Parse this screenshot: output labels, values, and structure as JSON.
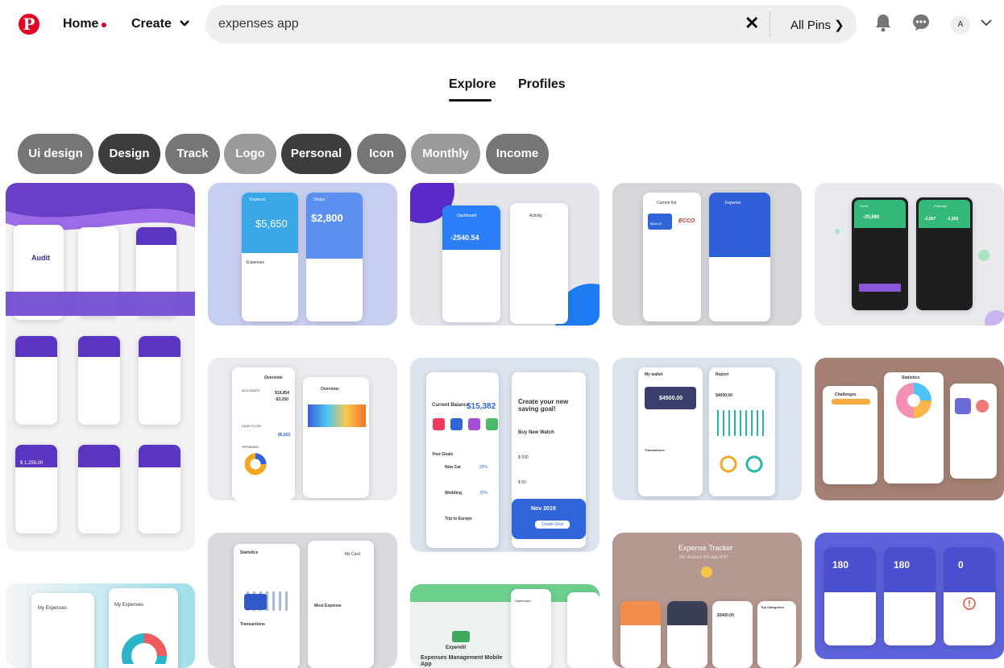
{
  "header": {
    "logo": "P",
    "home_label": "Home",
    "create_label": "Create",
    "create_chevron": "chevron-down-icon",
    "search_value": "expenses app",
    "clear_glyph": "✕",
    "filter_label": "All Pins ❯",
    "avatar_initial": "A",
    "colors": {
      "brand": "#e60023",
      "search_bg": "#efefef"
    }
  },
  "tabs": [
    {
      "label": "Explore",
      "active": true
    },
    {
      "label": "Profiles",
      "active": false
    }
  ],
  "chips": [
    {
      "label": "Ui design",
      "color": "#767676"
    },
    {
      "label": "Design",
      "color": "#3d3d3d"
    },
    {
      "label": "Track",
      "color": "#767676"
    },
    {
      "label": "Logo",
      "color": "#9a9a9a"
    },
    {
      "label": "Personal",
      "color": "#3d3d3d"
    },
    {
      "label": "Icon",
      "color": "#767676"
    },
    {
      "label": "Monthly",
      "color": "#9a9a9a"
    },
    {
      "label": "Income",
      "color": "#767676"
    }
  ],
  "pins": {
    "p1": {
      "brand": "Audit",
      "balance": "$ 1,256.00"
    },
    "p2": {
      "left_title": "Expense",
      "left_amount": "$5,650",
      "right_title": "Shops",
      "right_amount": "$2,800",
      "section": "Expenses"
    },
    "p3": {
      "title": "Dashboard",
      "amount": "-2540.54",
      "right_title": "Activity"
    },
    "p4": {
      "title": "Current list",
      "amount": "$650.00",
      "brand": "ECCO",
      "right_title": "Expense"
    },
    "p5": {
      "left_title": "Home",
      "left_amount": "-25,690",
      "right_title": "February",
      "right_amount": "-2,567",
      "right_amount2": "-2,569"
    },
    "p6": {
      "left_title": "Overview",
      "right_title": "Overview",
      "amount1": "$19,854",
      "amount2": "-$3,250",
      "amount3": "$6,823",
      "label_accounts": "ACCOUNTS",
      "label_cashflow": "CASH FLOW",
      "label_spending": "SPENDING"
    },
    "p7": {
      "balance_label": "Current Balance",
      "balance": "$15,382",
      "headline": "Create your new saving goal!",
      "item": "Buy New Watch",
      "amount_a": "$ 500",
      "amount_b": "$ 50",
      "footer_date": "Nov 2019",
      "footer_btn": "Create Goal",
      "goals": "Your Goals",
      "goal1": "New Car",
      "goal2": "Wedding",
      "goal3": "Trip to Europe",
      "goal1_pct": "25%",
      "goal2_pct": "70%"
    },
    "p8": {
      "left_title": "My wallet",
      "right_title": "Report",
      "left_amount": "$4500.00",
      "right_amount": "$4000.00",
      "transactions": "Transactions"
    },
    "p9": {
      "left_title": "Challenges",
      "center_title": "Statistics"
    },
    "p10": {
      "left_title": "Statistics",
      "right_title": "My Card",
      "transactions": "Transactions",
      "most": "Most Expense"
    },
    "p11": {
      "title": "Expense Tracker",
      "subtitle": "15+ Screens iOS App of 87",
      "amount": "$3400.00",
      "right_title": "Top Categories"
    },
    "p12": {
      "amount1": "180",
      "amount2": "180",
      "amount3": "0"
    },
    "p13": {
      "left_title": "My Expenses",
      "right_title": "My Expenses"
    },
    "p14": {
      "brand": "Expendit",
      "caption": "Expenses Management Mobile App",
      "right_title": "Dashboard"
    }
  }
}
